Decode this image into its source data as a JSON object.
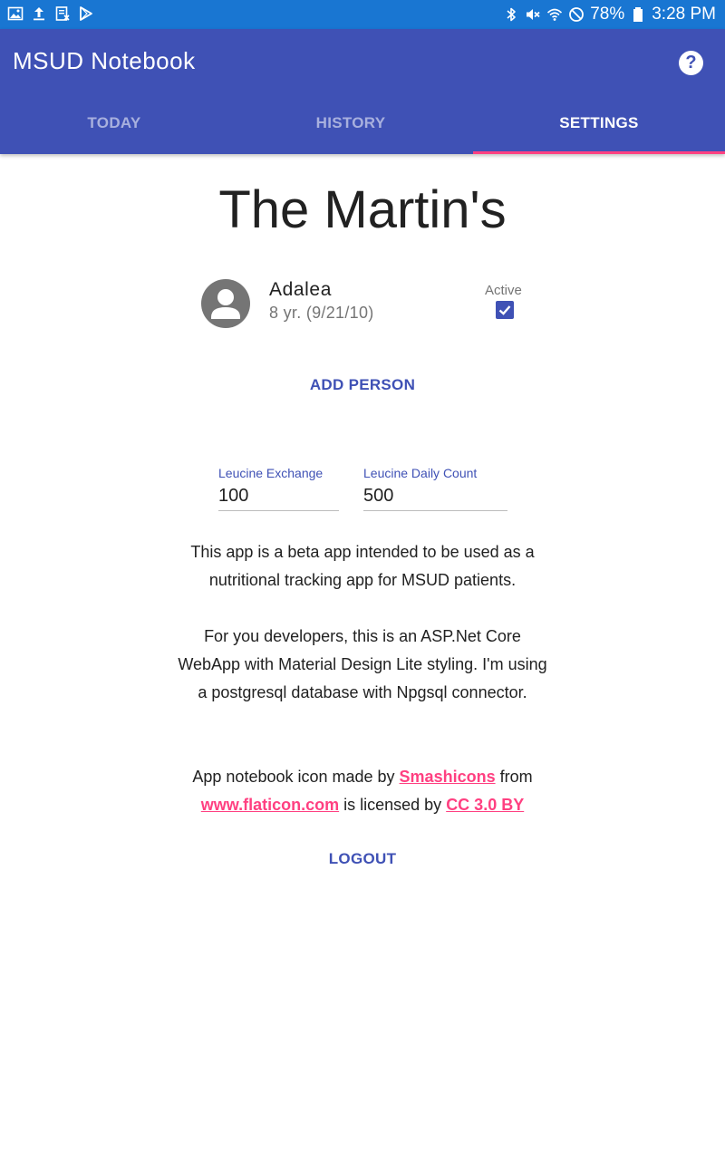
{
  "status_bar": {
    "left_icons": [
      "image-icon",
      "upload-icon",
      "document-icon",
      "play-store-icon"
    ],
    "right_icons": [
      "bluetooth-icon",
      "mute-icon",
      "wifi-icon",
      "blocked-icon",
      "battery-icon"
    ],
    "battery": "78%",
    "time": "3:28 PM"
  },
  "app": {
    "title": "MSUD Notebook",
    "help_label": "?"
  },
  "tabs": [
    {
      "label": "TODAY",
      "active": false
    },
    {
      "label": "HISTORY",
      "active": false
    },
    {
      "label": "SETTINGS",
      "active": true
    }
  ],
  "family": {
    "title": "The Martin's"
  },
  "person": {
    "name": "Adalea",
    "age": "8 yr. (9/21/10)",
    "active_label": "Active",
    "active": true
  },
  "actions": {
    "add_person": "ADD PERSON",
    "logout": "LOGOUT"
  },
  "fields": {
    "leucine_exchange_label": "Leucine Exchange",
    "leucine_exchange_value": "100",
    "leucine_daily_label": "Leucine Daily Count",
    "leucine_daily_value": "500"
  },
  "info": {
    "p1": "This app is a beta app intended to be used as a nutritional tracking app for MSUD patients.",
    "p2": "For you developers, this is an ASP.Net Core WebApp with Material Design Lite styling. I'm using a postgresql database with Npgsql connector.",
    "credit_prefix": "App notebook icon made by ",
    "credit_author": "Smashicons",
    "credit_from": " from ",
    "credit_site": "www.flaticon.com",
    "credit_licensed": " is licensed by ",
    "credit_license": "CC 3.0 BY"
  },
  "colors": {
    "primary": "#3f51b5",
    "accent": "#ff4081",
    "status_bar": "#1976d2"
  }
}
